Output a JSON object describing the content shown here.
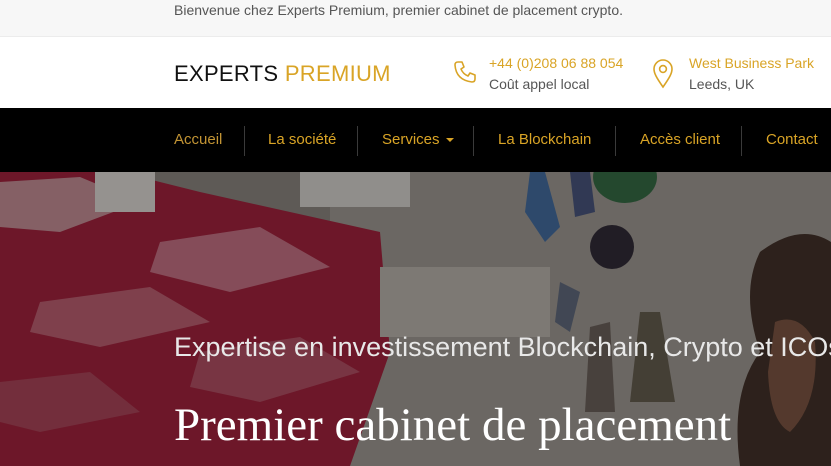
{
  "topbar": {
    "welcome_text": "Bienvenue chez Experts Premium, premier cabinet de placement crypto."
  },
  "header": {
    "logo": {
      "part1": "EXPERTS ",
      "part2": "PREMIUM"
    },
    "phone": {
      "icon": "phone-icon",
      "number": "+44 (0)208 06 88 054",
      "note": "Coût appel local"
    },
    "address": {
      "icon": "map-pin-icon",
      "line1": "West Business Park",
      "line2": "Leeds, UK"
    }
  },
  "nav": {
    "items": [
      {
        "label": "Accueil",
        "active": true
      },
      {
        "label": "La société"
      },
      {
        "label": "Services",
        "has_dropdown": true
      },
      {
        "label": "La Blockchain"
      },
      {
        "label": "Accès client"
      },
      {
        "label": "Contact"
      }
    ]
  },
  "hero": {
    "subtitle": "Expertise en investissement Blockchain, Crypto et ICOs",
    "title": "Premier cabinet de placement"
  },
  "colors": {
    "accent": "#d9a426",
    "nav_bg": "#000000",
    "topbar_bg": "#f7f7f7"
  }
}
